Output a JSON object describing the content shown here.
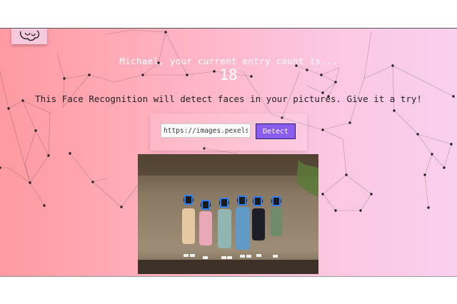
{
  "greeting": "Michael, your current entry count is...",
  "entry_count": "18",
  "intro": "This Face Recognition will detect faces in your pictures. Give it a try!",
  "search": {
    "value": "https://images.pexels.com",
    "button": "Detect"
  },
  "photo": {
    "faces_detected": 6
  },
  "colors": {
    "gradient_left": "#ff9aa0",
    "gradient_right": "#f9d0ee",
    "button": "#8a5cf0",
    "face_box": "#2d7ff9"
  },
  "icons": {
    "logo": "brain-icon"
  }
}
